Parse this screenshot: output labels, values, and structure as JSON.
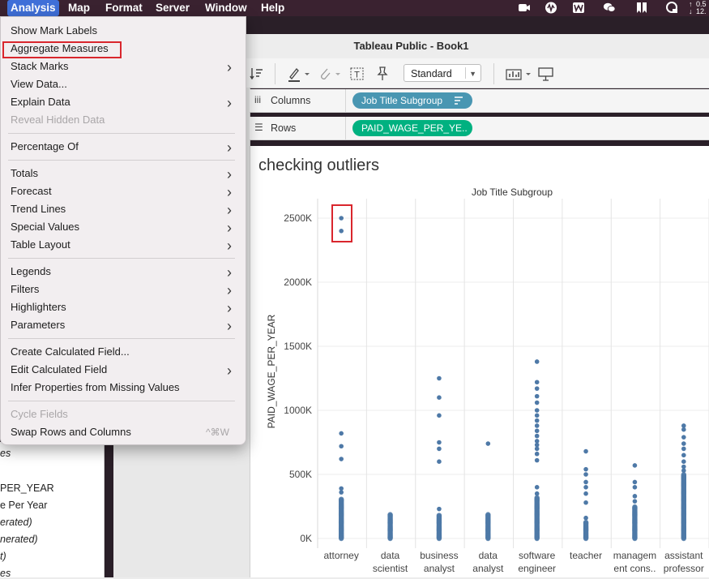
{
  "menubar": {
    "items": [
      "Analysis",
      "Map",
      "Format",
      "Server",
      "Window",
      "Help"
    ],
    "active": "Analysis",
    "status_top": "0.5",
    "status_bottom": "12."
  },
  "window": {
    "title": "Tableau Public - Book1"
  },
  "toolbar": {
    "fit_value": "Standard"
  },
  "shelves": {
    "columns_label": "Columns",
    "columns_pill": "Job Title Subgroup",
    "rows_label": "Rows",
    "rows_pill": "PAID_WAGE_PER_YE.."
  },
  "data_pane": {
    "items": [
      "es",
      "PER_YEAR",
      "e Per Year",
      "erated)",
      "nerated)",
      "t)",
      "es"
    ]
  },
  "menu": {
    "items": [
      {
        "label": "Show Mark Labels"
      },
      {
        "label": "Aggregate Measures"
      },
      {
        "label": "Stack Marks"
      },
      {
        "label": "View Data..."
      },
      {
        "label": "Explain Data"
      },
      {
        "label": "Reveal Hidden Data"
      },
      {
        "label": "Percentage Of"
      },
      {
        "label": "Totals"
      },
      {
        "label": "Forecast"
      },
      {
        "label": "Trend Lines"
      },
      {
        "label": "Special Values"
      },
      {
        "label": "Table Layout"
      },
      {
        "label": "Legends"
      },
      {
        "label": "Filters"
      },
      {
        "label": "Highlighters"
      },
      {
        "label": "Parameters"
      },
      {
        "label": "Create Calculated Field..."
      },
      {
        "label": "Edit Calculated Field"
      },
      {
        "label": "Infer Properties from Missing Values"
      },
      {
        "label": "Cycle Fields"
      },
      {
        "label": "Swap Rows and Columns",
        "shortcut": "^⌘W"
      }
    ]
  },
  "sheet": {
    "title": "checking outliers"
  },
  "colors": {
    "dot": "#4e79a7",
    "pill_dimension": "#4996b2",
    "pill_measure": "#00b180",
    "highlight": "#d9262d"
  },
  "chart_data": {
    "type": "scatter",
    "title": "checking outliers",
    "xlabel": "Job Title Subgroup",
    "ylabel": "PAID_WAGE_PER_YEAR",
    "y_unit": "K",
    "ylim": [
      0,
      2600
    ],
    "yticks": [
      0,
      500,
      1000,
      1500,
      2000,
      2500
    ],
    "ytick_labels": [
      "0K",
      "500K",
      "1000K",
      "1500K",
      "2000K",
      "2500K"
    ],
    "categories": [
      {
        "label": [
          "attorney",
          ""
        ],
        "outliers": [
          2500,
          2400,
          820,
          720,
          620,
          390,
          360
        ],
        "dense_min": 0,
        "dense_max": 310
      },
      {
        "label": [
          "data",
          "scientist"
        ],
        "outliers": [],
        "dense_min": 0,
        "dense_max": 190
      },
      {
        "label": [
          "business",
          "analyst"
        ],
        "outliers": [
          1250,
          1100,
          960,
          750,
          700,
          600,
          230
        ],
        "dense_min": 0,
        "dense_max": 180
      },
      {
        "label": [
          "data",
          "analyst"
        ],
        "outliers": [
          740
        ],
        "dense_min": 0,
        "dense_max": 190
      },
      {
        "label": [
          "software",
          "engineer"
        ],
        "outliers": [
          1380,
          1220,
          1170,
          1110,
          1060,
          1000,
          960,
          920,
          880,
          840,
          800,
          760,
          730,
          700,
          660,
          610,
          400,
          350
        ],
        "dense_min": 0,
        "dense_max": 320
      },
      {
        "label": [
          "teacher",
          ""
        ],
        "outliers": [
          680,
          540,
          500,
          440,
          400,
          350,
          280,
          160
        ],
        "dense_min": 0,
        "dense_max": 130
      },
      {
        "label": [
          "managem",
          "ent cons.."
        ],
        "outliers": [
          570,
          440,
          400,
          330,
          290
        ],
        "dense_min": 0,
        "dense_max": 250
      },
      {
        "label": [
          "assistant",
          "professor"
        ],
        "outliers": [
          880,
          850,
          790,
          740,
          700,
          650,
          600,
          560,
          530
        ],
        "dense_min": 0,
        "dense_max": 500
      }
    ],
    "grid": true,
    "highlighted_points": "attorney 2500K and 2400K"
  }
}
